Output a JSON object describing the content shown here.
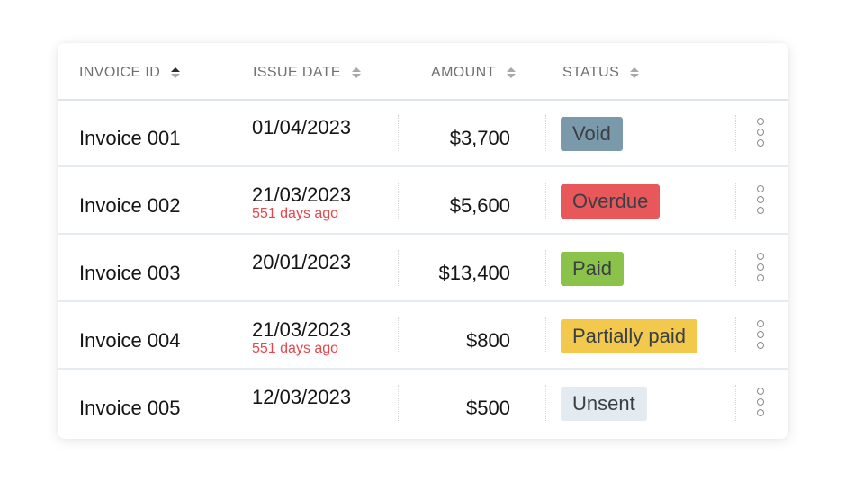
{
  "table": {
    "columns": [
      {
        "label": "INVOICE ID",
        "sort": "ascending"
      },
      {
        "label": "ISSUE DATE",
        "sort": "none"
      },
      {
        "label": "AMOUNT",
        "sort": "none"
      },
      {
        "label": "STATUS",
        "sort": "none"
      }
    ],
    "rows": [
      {
        "id": "Invoice 001",
        "date": "01/04/2023",
        "date_note": "",
        "amount": "$3,700",
        "status": "Void",
        "status_color": "#7a9aab"
      },
      {
        "id": "Invoice 002",
        "date": "21/03/2023",
        "date_note": "551 days ago",
        "amount": "$5,600",
        "status": "Overdue",
        "status_color": "#e8575a"
      },
      {
        "id": "Invoice 003",
        "date": "20/01/2023",
        "date_note": "",
        "amount": "$13,400",
        "status": "Paid",
        "status_color": "#8bc34a"
      },
      {
        "id": "Invoice 004",
        "date": "21/03/2023",
        "date_note": "551 days ago",
        "amount": "$800",
        "status": "Partially paid",
        "status_color": "#f2c94c"
      },
      {
        "id": "Invoice 005",
        "date": "12/03/2023",
        "date_note": "",
        "amount": "$500",
        "status": "Unsent",
        "status_color": "#e3eaf0"
      }
    ],
    "row_actions_icon": "more-vertical-icon"
  },
  "colors": {
    "overdue_note": "#e5484d",
    "header_text": "#6f6f6f"
  }
}
